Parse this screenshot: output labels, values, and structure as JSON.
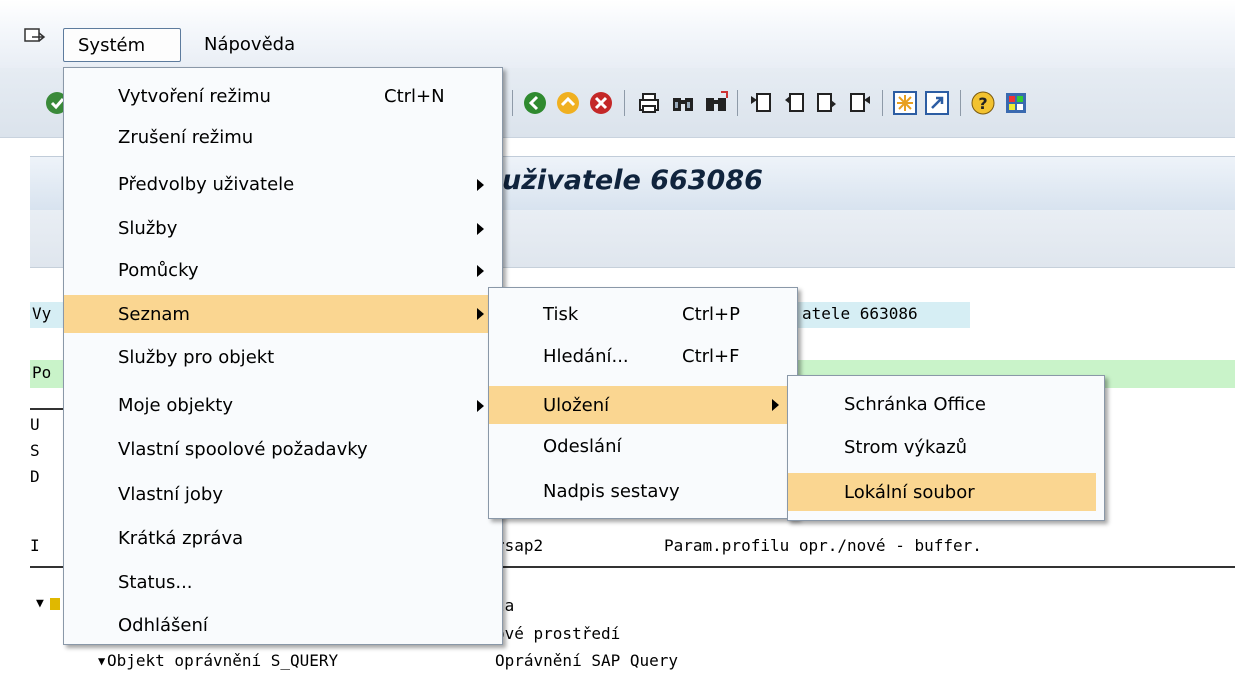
{
  "menubar": {
    "system_label": "Systém",
    "help_label": "Nápověda"
  },
  "title": {
    "visible_text": "uživatele 663086"
  },
  "report": {
    "header_fragment_left": "Vy",
    "header_fragment_right": "atele 663086",
    "green_fragment": "Po",
    "row_fragments_left": [
      "U",
      "S",
      "D",
      "I"
    ],
    "param_row_middle": "rsap2",
    "param_row_right": "Param.profilu opr./nové - buffer.",
    "tree_row1_right": "la",
    "tree_row2_right": "ové prostředí",
    "tree_row3_left": "Objekt oprávnění S_QUERY",
    "tree_row3_right": "Oprávnění SAP Query"
  },
  "system_menu": {
    "items": [
      {
        "label": "Vytvoření režimu",
        "shortcut": "Ctrl+N",
        "submenu": false
      },
      {
        "label": "Zrušení režimu",
        "shortcut": "",
        "submenu": false
      },
      {
        "label": "Předvolby uživatele",
        "shortcut": "",
        "submenu": true
      },
      {
        "label": "Služby",
        "shortcut": "",
        "submenu": true
      },
      {
        "label": "Pomůcky",
        "shortcut": "",
        "submenu": true
      },
      {
        "label": "Seznam",
        "shortcut": "",
        "submenu": true
      },
      {
        "label": "Služby pro objekt",
        "shortcut": "",
        "submenu": false
      },
      {
        "label": "Moje objekty",
        "shortcut": "",
        "submenu": true
      },
      {
        "label": "Vlastní spoolové požadavky",
        "shortcut": "",
        "submenu": false
      },
      {
        "label": "Vlastní joby",
        "shortcut": "",
        "submenu": false
      },
      {
        "label": "Krátká zpráva",
        "shortcut": "",
        "submenu": false
      },
      {
        "label": "Status...",
        "shortcut": "",
        "submenu": false
      },
      {
        "label": "Odhlášení",
        "shortcut": "",
        "submenu": false
      }
    ],
    "highlighted": "Seznam"
  },
  "list_menu": {
    "items": [
      {
        "label": "Tisk",
        "shortcut": "Ctrl+P",
        "submenu": false
      },
      {
        "label": "Hledání...",
        "shortcut": "Ctrl+F",
        "submenu": false
      },
      {
        "label": "Uložení",
        "shortcut": "",
        "submenu": true
      },
      {
        "label": "Odeslání",
        "shortcut": "",
        "submenu": false
      },
      {
        "label": "Nadpis sestavy",
        "shortcut": "",
        "submenu": false
      }
    ],
    "highlighted": "Uložení"
  },
  "save_menu": {
    "items": [
      {
        "label": "Schránka Office"
      },
      {
        "label": "Strom výkazů"
      },
      {
        "label": "Lokální soubor"
      }
    ],
    "highlighted": "Lokální soubor"
  },
  "colors": {
    "menu_highlight": "#fad691",
    "header_band": "#d6eef4",
    "green_band": "#c9f3c9",
    "title_text": "#10243d"
  },
  "toolbar_icons": [
    "back-icon",
    "exit-icon",
    "cancel-icon",
    "print-icon",
    "find-icon",
    "find-next-icon",
    "first-page-icon",
    "previous-page-icon",
    "next-page-icon",
    "last-page-icon",
    "create-session-icon",
    "shortcut-icon",
    "help-icon",
    "customize-layout-icon"
  ]
}
